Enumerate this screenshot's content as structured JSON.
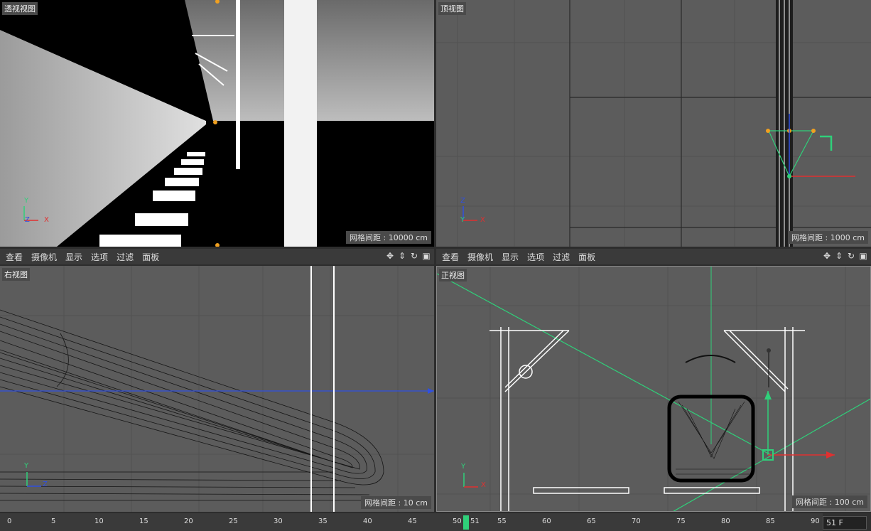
{
  "viewports": {
    "perspective": {
      "label": "透视视图",
      "grid": "网格间距 : 10000 cm"
    },
    "top": {
      "label": "顶视图",
      "grid": "网格间距 : 1000 cm"
    },
    "right": {
      "label": "右视图",
      "grid": "网格间距 : 10 cm"
    },
    "front": {
      "label": "正视图",
      "grid": "网格间距 : 100 cm"
    }
  },
  "menu": [
    "查看",
    "摄像机",
    "显示",
    "选项",
    "过滤",
    "面板"
  ],
  "menu_icons": [
    "move-view-icon",
    "zoom-view-icon",
    "rotate-view-icon",
    "maximize-view-icon"
  ],
  "axes": {
    "x": "X",
    "y": "Y",
    "z": "Z"
  },
  "timeline": {
    "ticks": [
      "0",
      "5",
      "10",
      "15",
      "20",
      "25",
      "30",
      "35",
      "40",
      "45",
      "50",
      "55",
      "60",
      "65",
      "70",
      "75",
      "80",
      "85",
      "90"
    ],
    "current": "51",
    "current_frame": "51 F"
  },
  "colors": {
    "grid_bg": "#5c5c5c",
    "accent_green": "#2fd07a",
    "axis_red": "#e03030",
    "axis_blue": "#3050e0"
  }
}
